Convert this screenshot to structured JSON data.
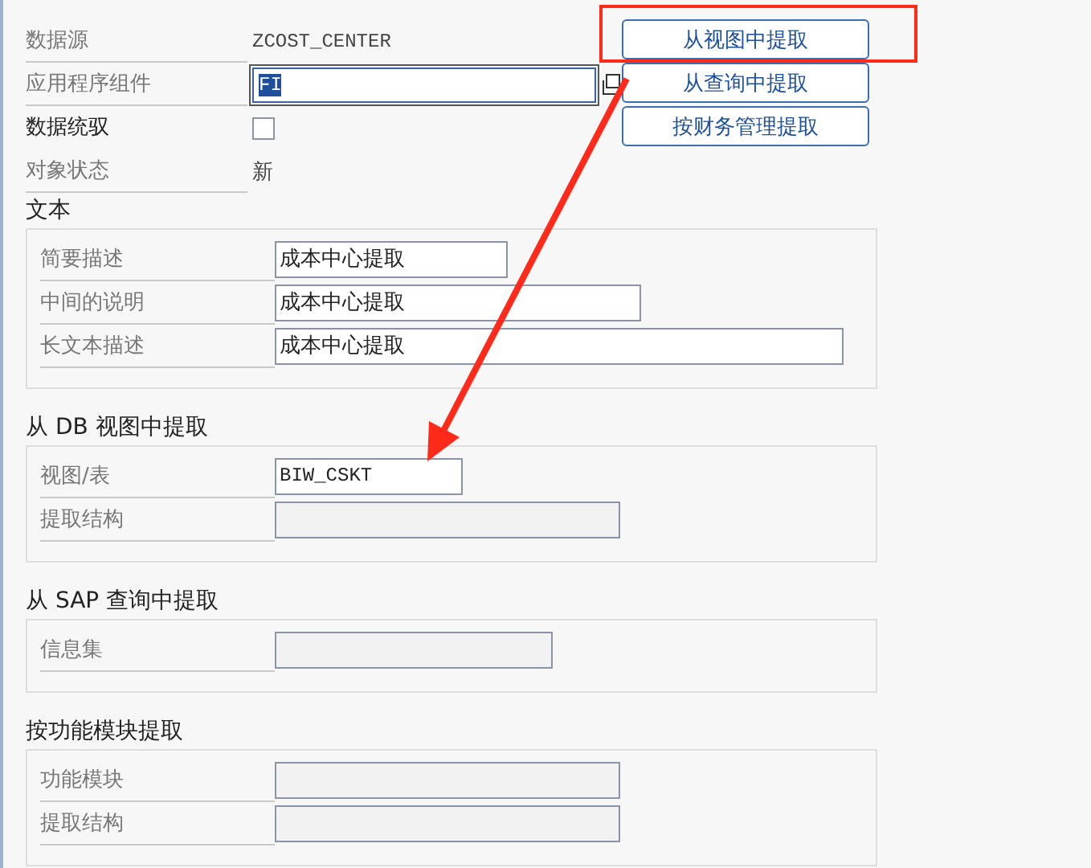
{
  "header": {
    "rows": [
      {
        "kind": "text",
        "label": "数据源",
        "value": "ZCOST_CENTER"
      },
      {
        "kind": "input",
        "label": "应用程序组件",
        "value": "FI",
        "text_selected": true
      },
      {
        "kind": "checkbox",
        "label": "数据统驭",
        "checked": false
      },
      {
        "kind": "text",
        "label": "对象状态",
        "value": "新"
      }
    ]
  },
  "buttons": [
    {
      "label": "从视图中提取",
      "annotated": true
    },
    {
      "label": "从查询中提取",
      "annotated": false
    },
    {
      "label": "按财务管理提取",
      "annotated": false
    }
  ],
  "sections": [
    {
      "title": "文本",
      "fields": [
        {
          "label": "简要描述",
          "value": "成本中心提取",
          "disabled": false
        },
        {
          "label": "中间的说明",
          "value": "成本中心提取",
          "disabled": false
        },
        {
          "label": "长文本描述",
          "value": "成本中心提取",
          "disabled": false
        }
      ]
    },
    {
      "title": "从 DB 视图中提取",
      "fields": [
        {
          "label": "视图/表",
          "value": "BIW_CSKT",
          "disabled": false
        },
        {
          "label": "提取结构",
          "disabled": true
        }
      ]
    },
    {
      "title": "从 SAP 查询中提取",
      "fields": [
        {
          "label": "信息集",
          "disabled": true
        }
      ]
    },
    {
      "title": "按功能模块提取",
      "fields": [
        {
          "label": "功能模块",
          "disabled": true
        },
        {
          "label": "提取结构",
          "disabled": true
        }
      ]
    }
  ]
}
